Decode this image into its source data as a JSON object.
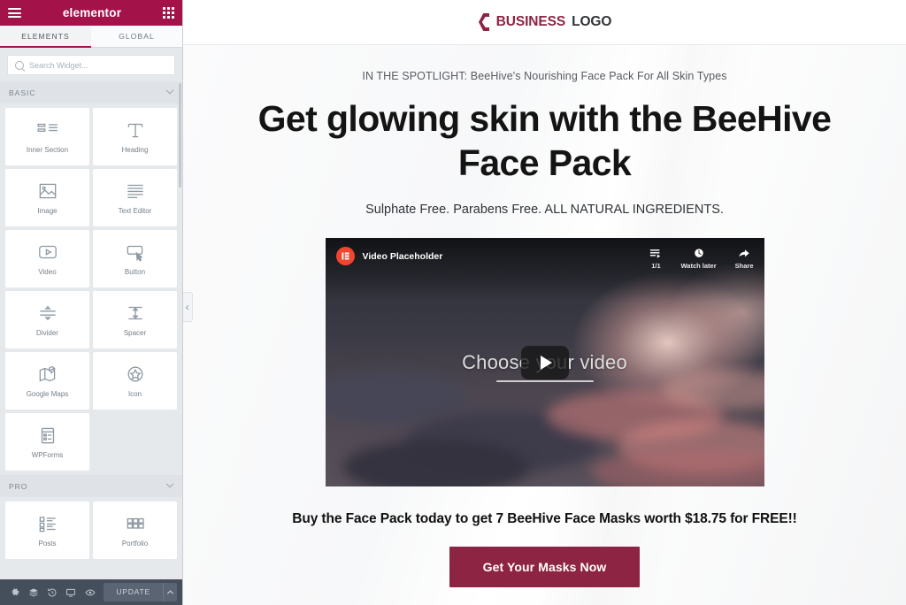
{
  "panel": {
    "brand": "elementor",
    "menu_icon": "hamburger-icon",
    "apps_icon": "grid-icon",
    "tabs": [
      {
        "label": "ELEMENTS",
        "active": true
      },
      {
        "label": "GLOBAL",
        "active": false
      }
    ],
    "search": {
      "placeholder": "Search Widget...",
      "value": "",
      "icon": "search-icon"
    },
    "categories": [
      {
        "name": "BASIC",
        "expanded": true,
        "widgets": [
          {
            "label": "Inner Section",
            "icon": "inner-section-icon"
          },
          {
            "label": "Heading",
            "icon": "heading-icon"
          },
          {
            "label": "Image",
            "icon": "image-icon"
          },
          {
            "label": "Text Editor",
            "icon": "text-editor-icon"
          },
          {
            "label": "Video",
            "icon": "video-icon"
          },
          {
            "label": "Button",
            "icon": "button-icon"
          },
          {
            "label": "Divider",
            "icon": "divider-icon"
          },
          {
            "label": "Spacer",
            "icon": "spacer-icon"
          },
          {
            "label": "Google Maps",
            "icon": "google-maps-icon"
          },
          {
            "label": "Icon",
            "icon": "star-icon"
          },
          {
            "label": "WPForms",
            "icon": "wpforms-icon"
          }
        ]
      },
      {
        "name": "PRO",
        "expanded": true,
        "widgets": [
          {
            "label": "Posts",
            "icon": "posts-icon"
          },
          {
            "label": "Portfolio",
            "icon": "portfolio-icon"
          }
        ]
      }
    ],
    "footer": {
      "icons": [
        {
          "name": "settings-icon"
        },
        {
          "name": "navigator-icon"
        },
        {
          "name": "history-icon"
        },
        {
          "name": "responsive-mode-icon"
        },
        {
          "name": "preview-icon"
        }
      ],
      "update_label": "UPDATE",
      "update_arrow": "chevron-up-icon"
    },
    "collapse_icon": "chevron-left-icon"
  },
  "site": {
    "logo": {
      "business": "BUSINESS",
      "word": "LOGO",
      "mark": "hex-bracket-icon"
    },
    "eyebrow": "IN THE SPOTLIGHT: BeeHive's Nourishing Face Pack For All Skin Types",
    "headline": "Get glowing skin with the BeeHive Face Pack",
    "subheading": "Sulphate Free. Parabens Free. ALL NATURAL INGREDIENTS.",
    "video": {
      "channel_icon": "elementor-e-icon",
      "title": "Video Placeholder",
      "center_text": "Choose your video",
      "play_icon": "play-icon",
      "controls": [
        {
          "label": "1/1",
          "icon": "playlist-icon"
        },
        {
          "label": "Watch later",
          "icon": "clock-icon"
        },
        {
          "label": "Share",
          "icon": "share-arrow-icon"
        }
      ]
    },
    "offer": "Buy the Face Pack today to get 7 BeeHive Face Masks worth $18.75 for FREE!!",
    "cta_label": "Get Your Masks Now"
  },
  "colors": {
    "brand_maroon": "#a4124a",
    "cta_maroon": "#8e2444",
    "panel_bg": "#e6e9ec",
    "footer_bg": "#454f5b",
    "youtube_red": "#f1452f"
  }
}
